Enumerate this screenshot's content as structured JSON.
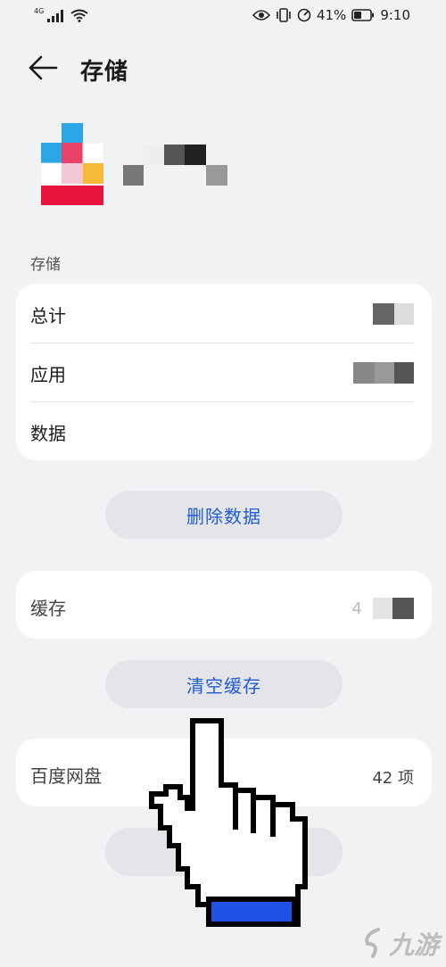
{
  "status_bar": {
    "network": "4G",
    "battery_percent": "41%",
    "time": "9:10"
  },
  "header": {
    "title": "存储"
  },
  "storage_section": {
    "label": "存储",
    "rows": [
      {
        "label": "总计"
      },
      {
        "label": "应用"
      },
      {
        "label": "数据"
      }
    ],
    "delete_button": "删除数据"
  },
  "cache_section": {
    "label": "缓存",
    "value_visible": "4",
    "clear_button": "清空缓存"
  },
  "baidu_section": {
    "label": "百度网盘",
    "value": "42 项"
  },
  "watermark": {
    "text": "九游"
  },
  "colors": {
    "accent": "#1f5bd1",
    "background": "#f1f2f4",
    "card": "#ffffff"
  }
}
